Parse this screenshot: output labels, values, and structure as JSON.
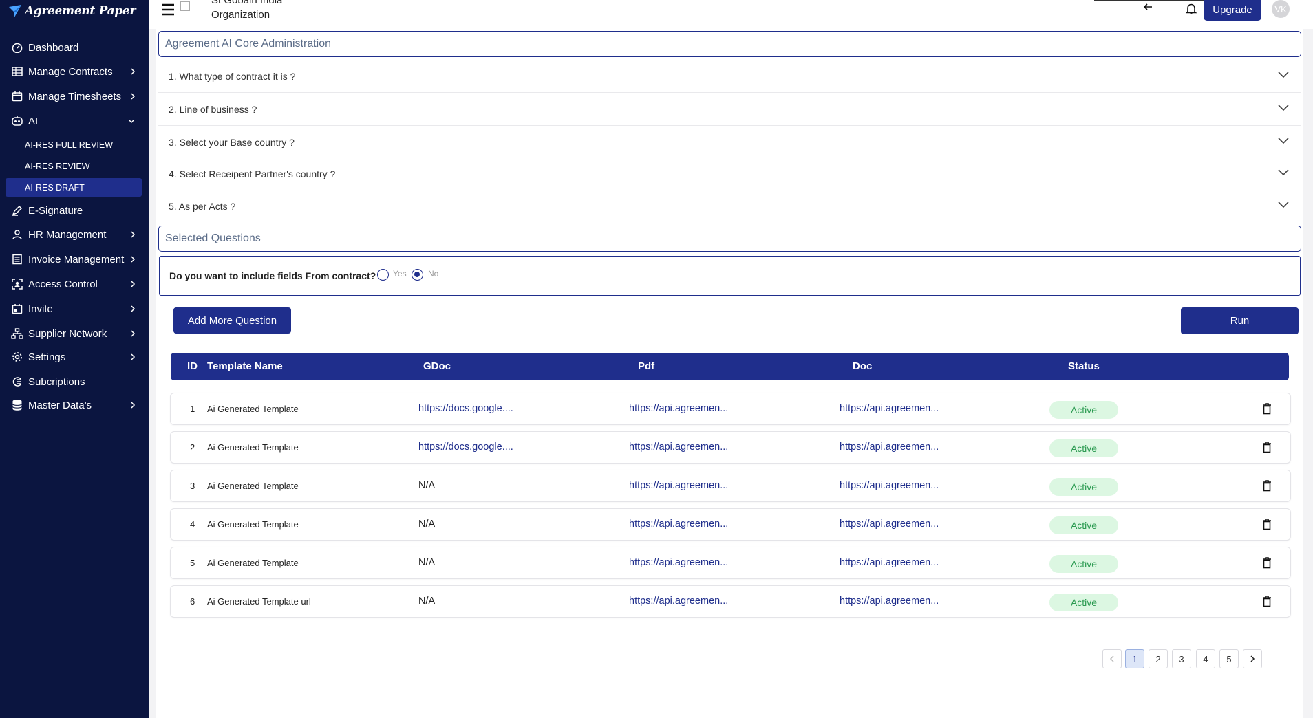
{
  "brand": {
    "name": "Agreement Paper"
  },
  "sidebar": {
    "items": [
      {
        "label": "Dashboard",
        "icon": "dashboard-icon"
      },
      {
        "label": "Manage Contracts",
        "icon": "contracts-icon"
      },
      {
        "label": "Manage Timesheets",
        "icon": "calendar-icon"
      },
      {
        "label": "AI",
        "icon": "robot-icon"
      },
      {
        "label": "E-Signature",
        "icon": "signature-icon"
      },
      {
        "label": "HR Management",
        "icon": "user-icon"
      },
      {
        "label": "Invoice Management",
        "icon": "invoice-icon"
      },
      {
        "label": "Access Control",
        "icon": "access-icon"
      },
      {
        "label": "Invite",
        "icon": "invite-icon"
      },
      {
        "label": "Supplier Network",
        "icon": "network-icon"
      },
      {
        "label": "Settings",
        "icon": "gear-icon"
      },
      {
        "label": "Subcriptions",
        "icon": "subscription-icon"
      },
      {
        "label": "Master Data's",
        "icon": "database-icon"
      }
    ],
    "ai_sub": [
      "AI-RES FULL REVIEW",
      "AI-RES REVIEW",
      "AI-RES DRAFT"
    ]
  },
  "header": {
    "org_line1": "St Gobain India",
    "org_line2": "Organization",
    "upgrade_label": "Upgrade",
    "avatar_initials": "VK"
  },
  "admin": {
    "title": "Agreement AI Core Administration",
    "questions": [
      "1. What type of contract it is ?",
      "2. Line of business ?",
      "3. Select your Base country ?",
      "4. Select Receipent Partner's country ?",
      "5. As per Acts ?"
    ],
    "selected_title": "Selected Questions",
    "include_question": "Do you want to include fields From contract?",
    "yes_label": "Yes",
    "no_label": "No",
    "include_value": "No"
  },
  "actions": {
    "add_more": "Add More Question",
    "run": "Run"
  },
  "table": {
    "headers": [
      "ID",
      "Template Name",
      "GDoc",
      "Pdf",
      "Doc",
      "Status"
    ],
    "rows": [
      {
        "id": "1",
        "name": "Ai Generated Template",
        "gdoc": "https://docs.google....",
        "pdf": "https://api.agreemen...",
        "doc": "https://api.agreemen...",
        "status": "Active"
      },
      {
        "id": "2",
        "name": "Ai Generated Template",
        "gdoc": "https://docs.google....",
        "pdf": "https://api.agreemen...",
        "doc": "https://api.agreemen...",
        "status": "Active"
      },
      {
        "id": "3",
        "name": "Ai Generated Template",
        "gdoc": "N/A",
        "pdf": "https://api.agreemen...",
        "doc": "https://api.agreemen...",
        "status": "Active"
      },
      {
        "id": "4",
        "name": "Ai Generated Template",
        "gdoc": "N/A",
        "pdf": "https://api.agreemen...",
        "doc": "https://api.agreemen...",
        "status": "Active"
      },
      {
        "id": "5",
        "name": "Ai Generated Template",
        "gdoc": "N/A",
        "pdf": "https://api.agreemen...",
        "doc": "https://api.agreemen...",
        "status": "Active"
      },
      {
        "id": "6",
        "name": "Ai Generated Template url",
        "gdoc": "N/A",
        "pdf": "https://api.agreemen...",
        "doc": "https://api.agreemen...",
        "status": "Active"
      }
    ]
  },
  "pagination": {
    "pages": [
      "1",
      "2",
      "3",
      "4",
      "5"
    ],
    "current": "1"
  },
  "colors": {
    "sidebar_bg": "#0b1540",
    "accent": "#1f2e8c",
    "active_badge_bg": "#dcf7e2",
    "active_badge_text": "#2a9a50"
  }
}
